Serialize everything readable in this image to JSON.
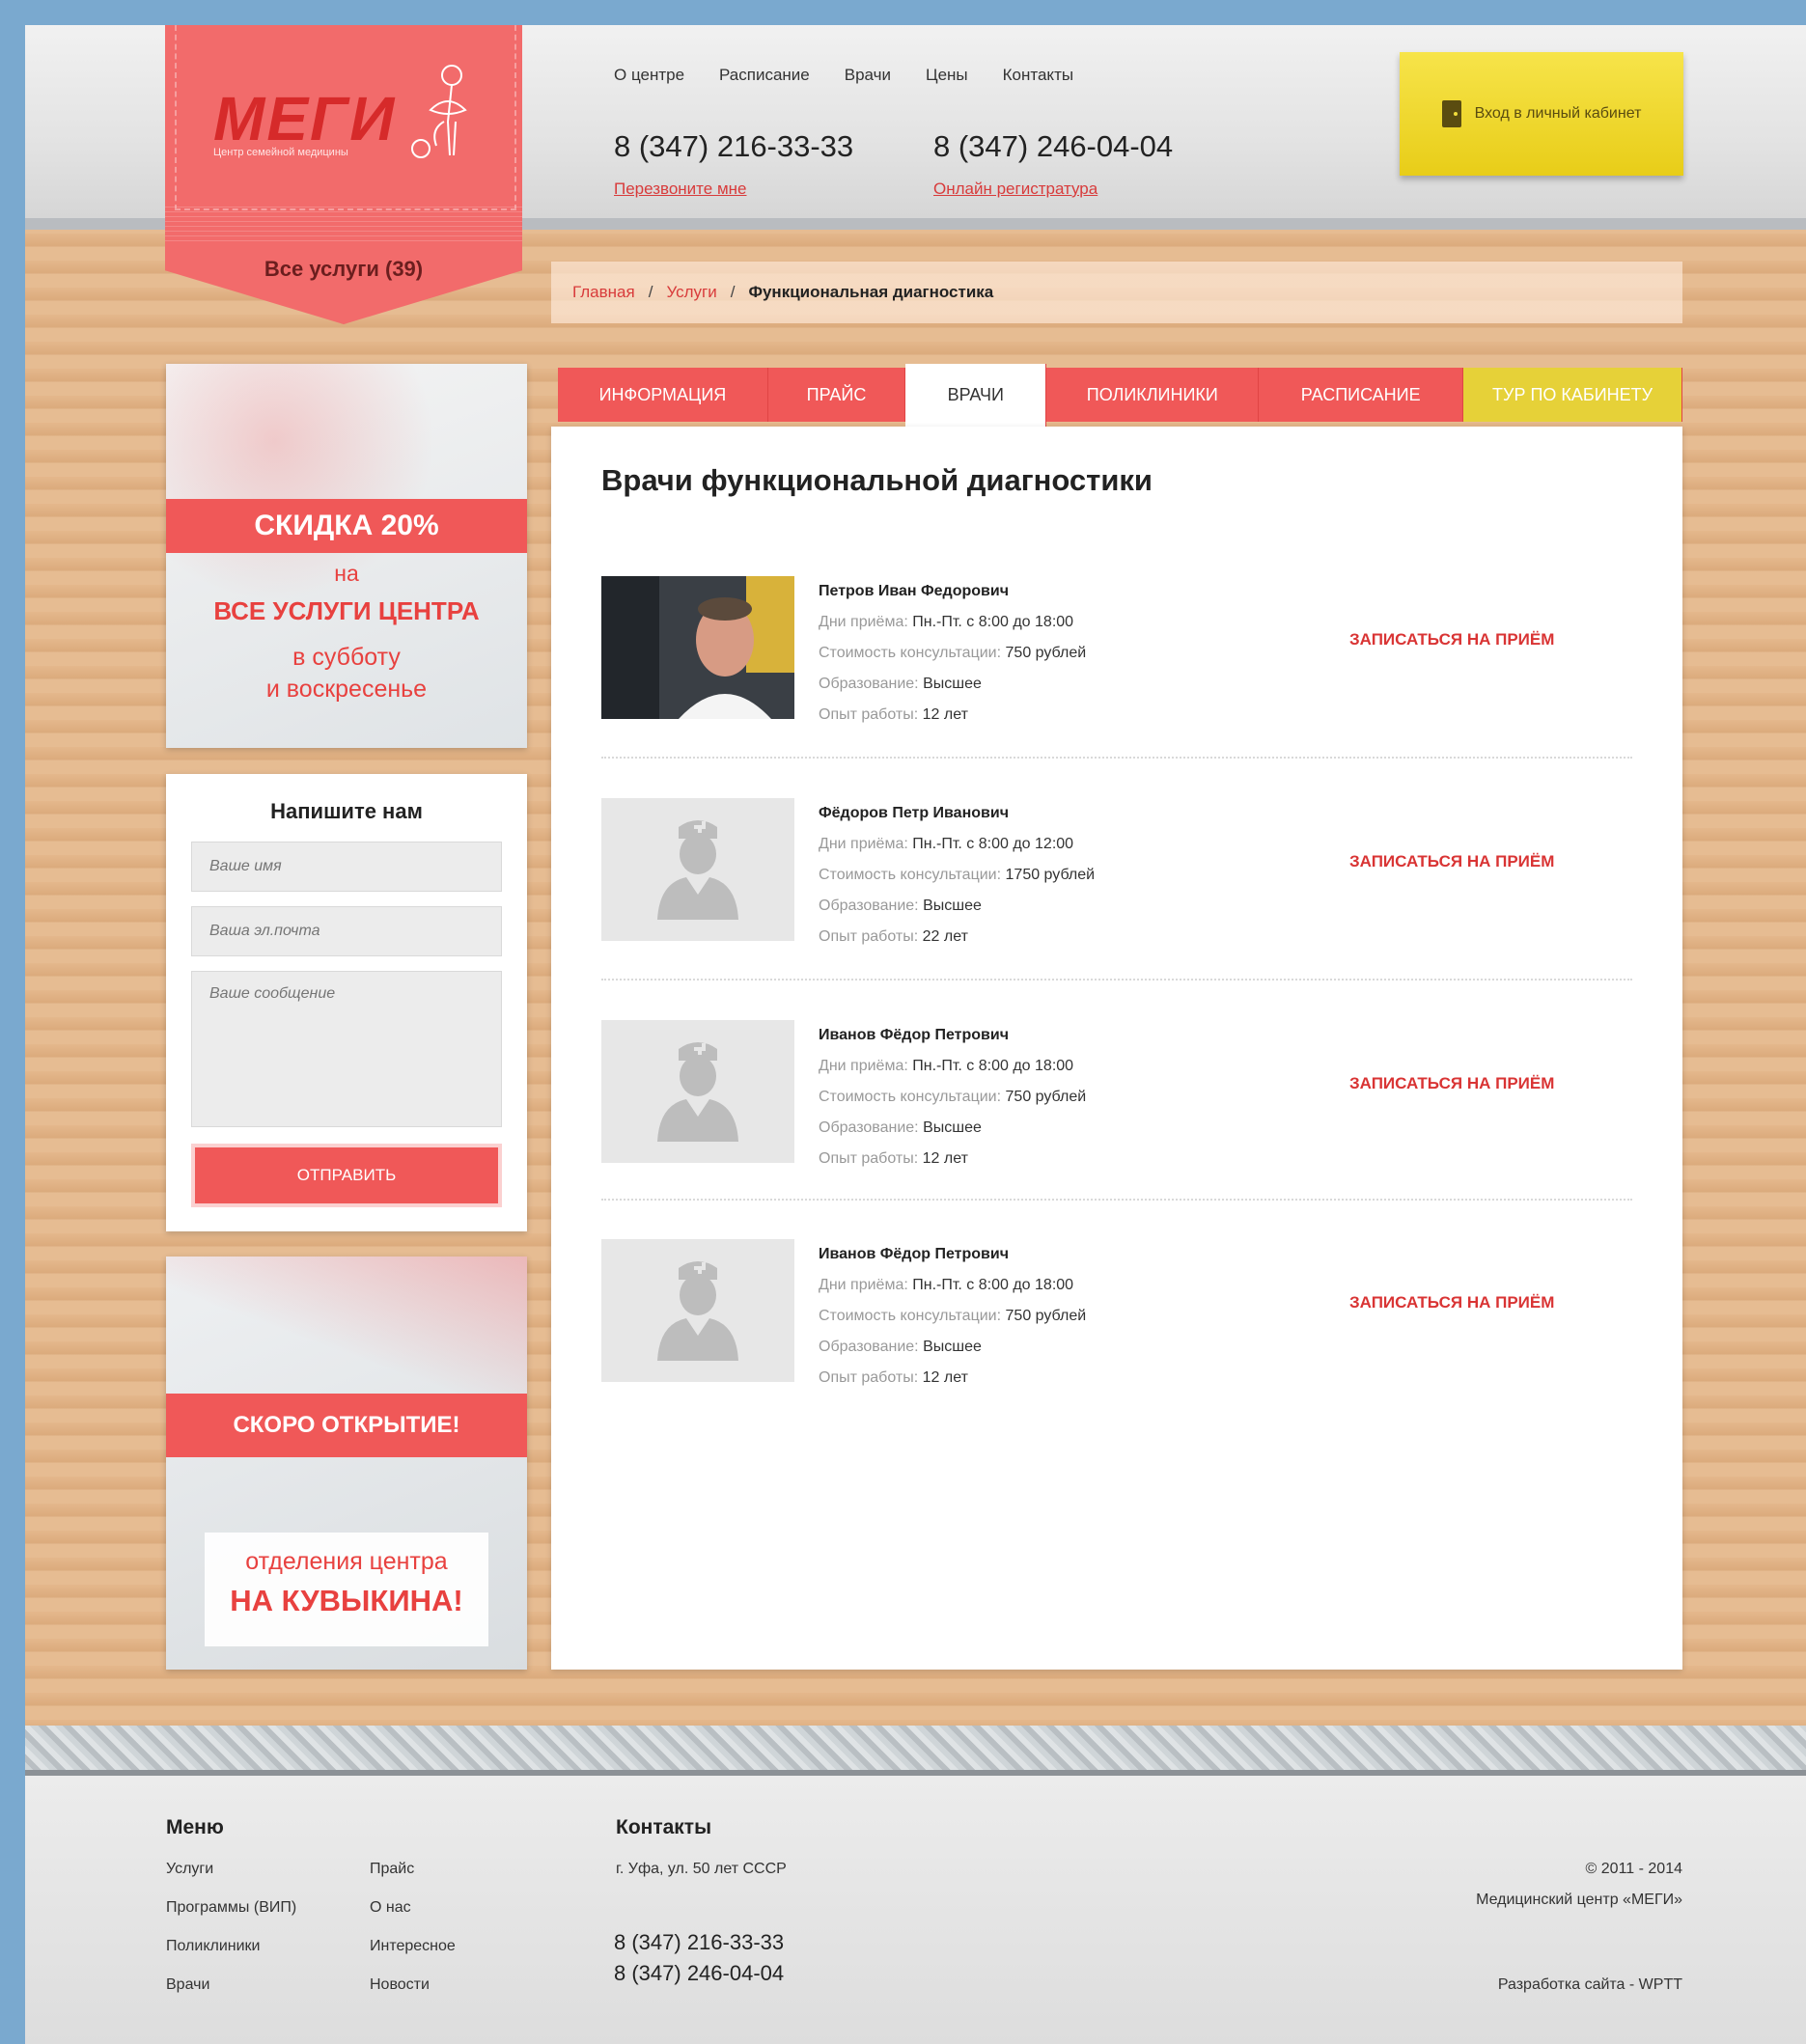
{
  "header": {
    "logo_text": "МЕГИ",
    "logo_subtitle": "Центр семейной медицины",
    "all_services": "Все услуги (39)",
    "nav": [
      "О центре",
      "Расписание",
      "Врачи",
      "Цены",
      "Контакты"
    ],
    "phone1": "8 (347) 216-33-33",
    "phone1_link": "Перезвоните мне",
    "phone2": "8 (347) 246-04-04",
    "phone2_link": "Онлайн регистратура",
    "cabinet_label": "Вход в личный кабинет"
  },
  "breadcrumb": {
    "home": "Главная",
    "services": "Услуги",
    "current": "Функциональная диагностика",
    "separator": "/"
  },
  "promo1": {
    "band": "СКИДКА 20%",
    "line1": "на",
    "line2": "ВСЕ УСЛУГИ ЦЕНТРА",
    "line3": "в субботу",
    "line4": "и воскресенье"
  },
  "form": {
    "title": "Напишите нам",
    "name_placeholder": "Ваше имя",
    "email_placeholder": "Ваша эл.почта",
    "message_placeholder": "Ваше сообщение",
    "submit": "ОТПРАВИТЬ"
  },
  "promo2": {
    "band": "СКОРО ОТКРЫТИЕ!",
    "line1": "отделения центра",
    "line2": "НА КУВЫКИНА!"
  },
  "tabs": [
    "ИНФОРМАЦИЯ",
    "ПРАЙС",
    "ВРАЧИ",
    "ПОЛИКЛИНИКИ",
    "РАСПИСАНИЕ",
    "ТУР ПО КАБИНЕТУ"
  ],
  "content": {
    "title": "Врачи функциональной диагностики",
    "labels": {
      "days": "Дни приёма:",
      "cost": "Стоимость консультации:",
      "education": "Образование:",
      "experience": "Опыт работы:"
    },
    "book_label": "ЗАПИСАТЬСЯ НА ПРИЁМ",
    "doctors": [
      {
        "name": "Петров Иван Федорович",
        "days": "Пн.-Пт. с 8:00 до 18:00",
        "cost": "750 рублей",
        "education": "Высшее",
        "experience": "12 лет"
      },
      {
        "name": "Фёдоров Петр Иванович",
        "days": "Пн.-Пт. с 8:00 до 12:00",
        "cost": "1750 рублей",
        "education": "Высшее",
        "experience": "22 лет"
      },
      {
        "name": "Иванов Фёдор Петрович",
        "days": "Пн.-Пт. с 8:00 до 18:00",
        "cost": "750 рублей",
        "education": "Высшее",
        "experience": "12 лет"
      },
      {
        "name": "Иванов Фёдор Петрович",
        "days": "Пн.-Пт. с 8:00 до 18:00",
        "cost": "750 рублей",
        "education": "Высшее",
        "experience": "12 лет"
      }
    ]
  },
  "footer": {
    "menu_title": "Меню",
    "menu_col1": [
      "Услуги",
      "Программы (ВИП)",
      "Поликлиники",
      "Врачи"
    ],
    "menu_col2": [
      "Прайс",
      "О нас",
      "Интересное",
      "Новости"
    ],
    "contacts_title": "Контакты",
    "address": "г. Уфа, ул. 50 лет СССР",
    "phone1": "8 (347) 216-33-33",
    "phone2": "8 (347) 246-04-04",
    "copyright": "© 2011 - 2014",
    "company": "Медицинский центр «МЕГИ»",
    "developer": "Разработка сайта - WPTT"
  },
  "colors": {
    "accent_red": "#f05858",
    "link_red": "#d83b3b",
    "yellow": "#e6d138",
    "wood": "#e3b486"
  }
}
